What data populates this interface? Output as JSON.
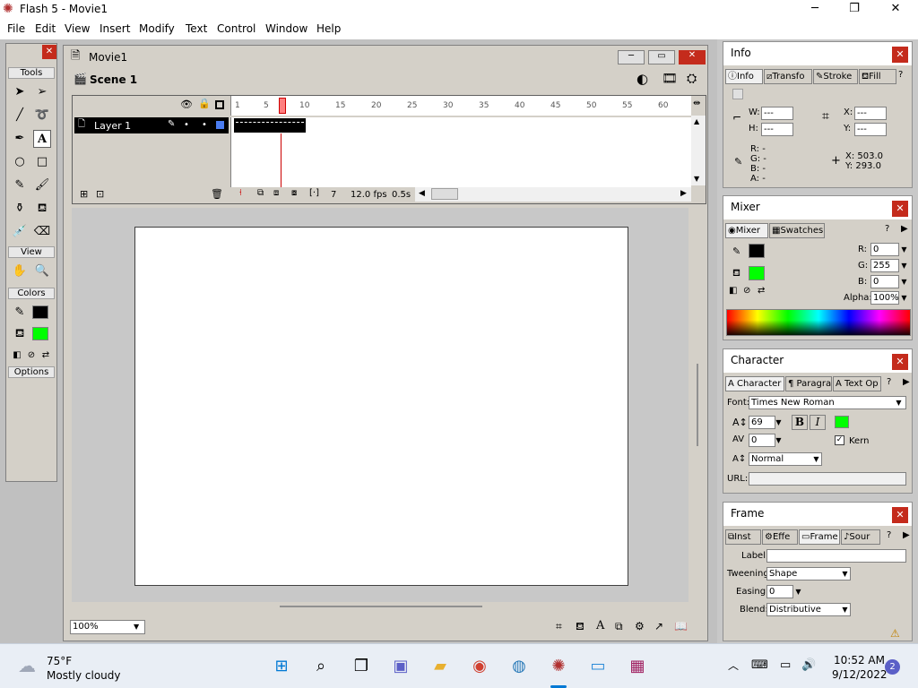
{
  "window": {
    "title": "Flash 5 - Movie1"
  },
  "menu": [
    "File",
    "Edit",
    "View",
    "Insert",
    "Modify",
    "Text",
    "Control",
    "Window",
    "Help"
  ],
  "tools": {
    "header": "Tools",
    "view_label": "View",
    "colors_label": "Colors",
    "options_label": "Options"
  },
  "movie": {
    "title": "Movie1",
    "scene": "Scene 1",
    "zoom": "100%"
  },
  "timeline": {
    "layer_name": "Layer 1",
    "frame_numbers": [
      "1",
      "5",
      "10",
      "15",
      "20",
      "25",
      "30",
      "35",
      "40",
      "45",
      "50",
      "55",
      "60"
    ],
    "current_frame": "7",
    "fps": "12.0 fps",
    "elapsed": "0.5s"
  },
  "info_panel": {
    "title": "Info",
    "tabs": [
      "Info",
      "Transfo",
      "Stroke",
      "Fill"
    ],
    "w_label": "W:",
    "w_value": "---",
    "h_label": "H:",
    "h_value": "---",
    "x_label": "X:",
    "x_value": "---",
    "y_label": "Y:",
    "y_value": "---",
    "rgba": [
      "R: -",
      "G: -",
      "B: -",
      "A: -"
    ],
    "cursor_x": "X: 503.0",
    "cursor_y": "Y: 293.0"
  },
  "mixer_panel": {
    "title": "Mixer",
    "tabs": [
      "Mixer",
      "Swatches"
    ],
    "r_label": "R:",
    "r_value": "0",
    "g_label": "G:",
    "g_value": "255",
    "b_label": "B:",
    "b_value": "0",
    "alpha_label": "Alpha:",
    "alpha_value": "100%"
  },
  "character_panel": {
    "title": "Character",
    "tabs": [
      "Character",
      "Paragra",
      "Text Op"
    ],
    "font_label": "Font:",
    "font_value": "Times New Roman",
    "size_value": "69",
    "tracking_value": "0",
    "kern_label": "Kern",
    "baseline_value": "Normal",
    "url_label": "URL:"
  },
  "frame_panel": {
    "title": "Frame",
    "tabs": [
      "Inst",
      "Effe",
      "Frame",
      "Sour"
    ],
    "label_label": "Label:",
    "tweening_label": "Tweening:",
    "tweening_value": "Shape",
    "easing_label": "Easing:",
    "easing_value": "0",
    "blend_label": "Blend:",
    "blend_value": "Distributive"
  },
  "taskbar": {
    "weather_temp": "75°F",
    "weather_desc": "Mostly cloudy",
    "time": "10:52 AM",
    "date": "9/12/2022",
    "notifications": "2"
  },
  "colors": {
    "stroke": "#000000",
    "fill": "#00ff00",
    "close_red": "#c42b1c",
    "accent": "#0078d4"
  }
}
